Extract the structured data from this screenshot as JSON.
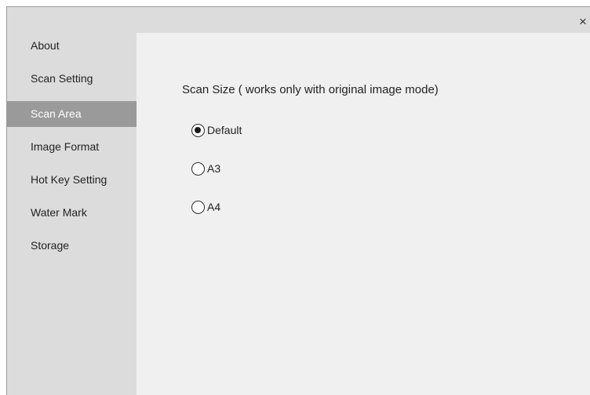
{
  "window": {
    "close_glyph": "×"
  },
  "sidebar": {
    "items": [
      {
        "label": "About",
        "active": false
      },
      {
        "label": "Scan Setting",
        "active": false
      },
      {
        "label": "Scan Area",
        "active": true
      },
      {
        "label": "Image Format",
        "active": false
      },
      {
        "label": "Hot Key Setting",
        "active": false
      },
      {
        "label": "Water Mark",
        "active": false
      },
      {
        "label": "Storage",
        "active": false
      }
    ]
  },
  "main": {
    "section_title": "Scan Size ( works only with original image mode)",
    "options": [
      {
        "label": "Default",
        "checked": true
      },
      {
        "label": "A3",
        "checked": false
      },
      {
        "label": "A4",
        "checked": false
      }
    ]
  },
  "colors": {
    "sidebar_bg": "#dcdcdc",
    "active_item_bg": "#9a9a9a",
    "content_bg": "#f0f0f0"
  },
  "icons": {
    "close": "close-icon"
  }
}
